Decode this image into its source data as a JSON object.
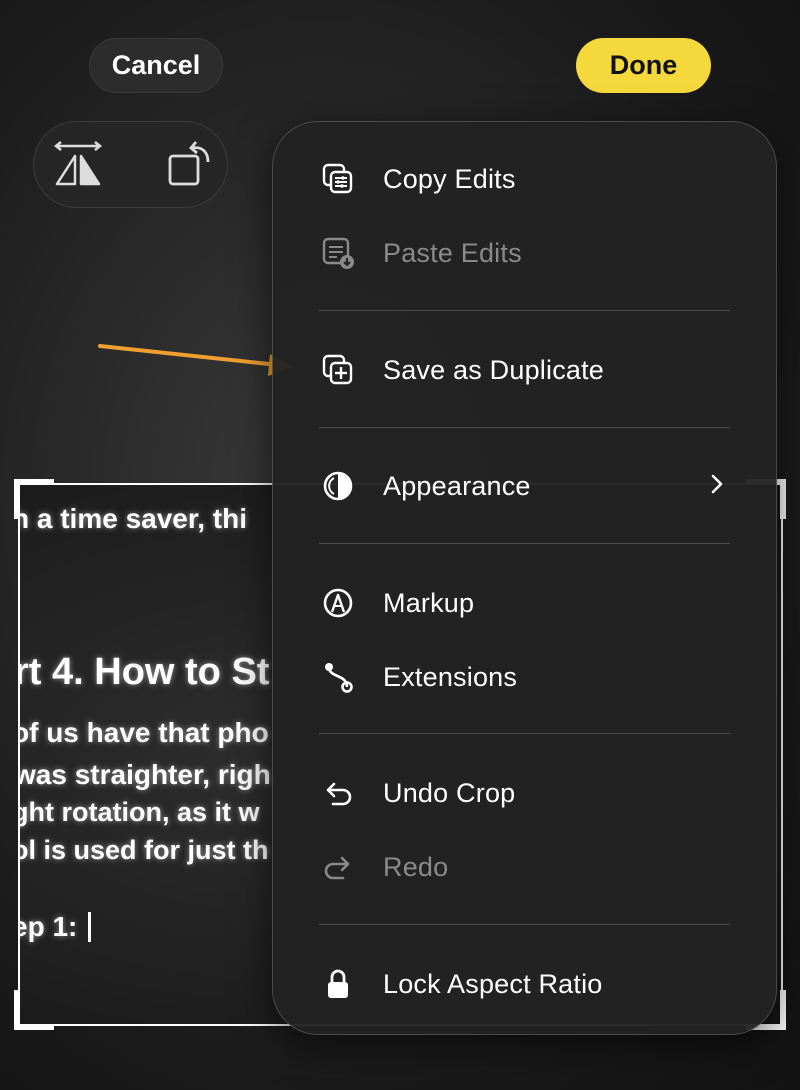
{
  "toolbar": {
    "cancel_label": "Cancel",
    "done_label": "Done",
    "done_color": "#f5d93c"
  },
  "tools": {
    "flip_icon": "flip-horizontal-icon",
    "rotate_icon": "rotate-icon"
  },
  "photo": {
    "lines": [
      "h a time saver, thi",
      "rt 4. How to St",
      "of us have that pho",
      "was straighter, righ",
      "ght rotation, as it w",
      "ol is used for just th",
      "ep 1:"
    ]
  },
  "annotation": {
    "arrow_color": "#f0a030"
  },
  "menu": {
    "items": [
      {
        "label": "Copy Edits",
        "icon": "copy-edits-icon",
        "enabled": true
      },
      {
        "label": "Paste Edits",
        "icon": "paste-edits-icon",
        "enabled": false
      },
      {
        "label": "Save as Duplicate",
        "icon": "duplicate-icon",
        "enabled": true
      },
      {
        "label": "Appearance",
        "icon": "appearance-icon",
        "enabled": true,
        "submenu": true
      },
      {
        "label": "Markup",
        "icon": "markup-icon",
        "enabled": true
      },
      {
        "label": "Extensions",
        "icon": "extensions-icon",
        "enabled": true
      },
      {
        "label": "Undo Crop",
        "icon": "undo-icon",
        "enabled": true
      },
      {
        "label": "Redo",
        "icon": "redo-icon",
        "enabled": false
      },
      {
        "label": "Lock Aspect Ratio",
        "icon": "lock-icon",
        "enabled": true
      }
    ]
  }
}
